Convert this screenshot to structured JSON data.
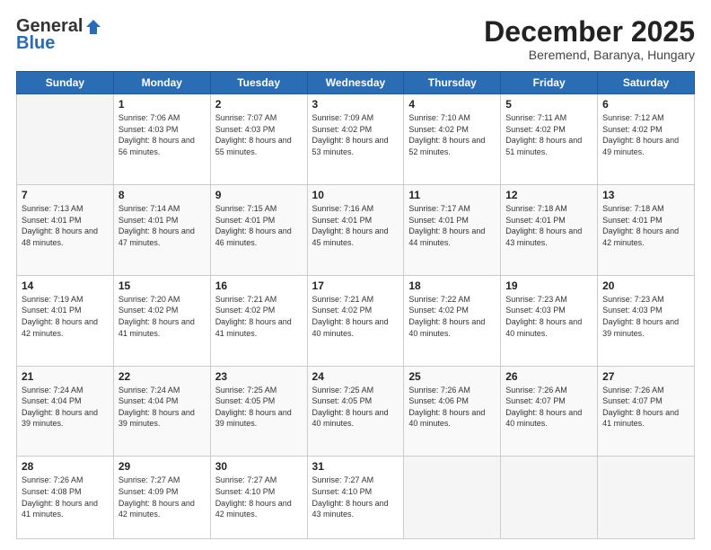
{
  "logo": {
    "general": "General",
    "blue": "Blue"
  },
  "title": "December 2025",
  "location": "Beremend, Baranya, Hungary",
  "headers": [
    "Sunday",
    "Monday",
    "Tuesday",
    "Wednesday",
    "Thursday",
    "Friday",
    "Saturday"
  ],
  "weeks": [
    [
      {
        "day": "",
        "sunrise": "",
        "sunset": "",
        "daylight": ""
      },
      {
        "day": "1",
        "sunrise": "Sunrise: 7:06 AM",
        "sunset": "Sunset: 4:03 PM",
        "daylight": "Daylight: 8 hours and 56 minutes."
      },
      {
        "day": "2",
        "sunrise": "Sunrise: 7:07 AM",
        "sunset": "Sunset: 4:03 PM",
        "daylight": "Daylight: 8 hours and 55 minutes."
      },
      {
        "day": "3",
        "sunrise": "Sunrise: 7:09 AM",
        "sunset": "Sunset: 4:02 PM",
        "daylight": "Daylight: 8 hours and 53 minutes."
      },
      {
        "day": "4",
        "sunrise": "Sunrise: 7:10 AM",
        "sunset": "Sunset: 4:02 PM",
        "daylight": "Daylight: 8 hours and 52 minutes."
      },
      {
        "day": "5",
        "sunrise": "Sunrise: 7:11 AM",
        "sunset": "Sunset: 4:02 PM",
        "daylight": "Daylight: 8 hours and 51 minutes."
      },
      {
        "day": "6",
        "sunrise": "Sunrise: 7:12 AM",
        "sunset": "Sunset: 4:02 PM",
        "daylight": "Daylight: 8 hours and 49 minutes."
      }
    ],
    [
      {
        "day": "7",
        "sunrise": "Sunrise: 7:13 AM",
        "sunset": "Sunset: 4:01 PM",
        "daylight": "Daylight: 8 hours and 48 minutes."
      },
      {
        "day": "8",
        "sunrise": "Sunrise: 7:14 AM",
        "sunset": "Sunset: 4:01 PM",
        "daylight": "Daylight: 8 hours and 47 minutes."
      },
      {
        "day": "9",
        "sunrise": "Sunrise: 7:15 AM",
        "sunset": "Sunset: 4:01 PM",
        "daylight": "Daylight: 8 hours and 46 minutes."
      },
      {
        "day": "10",
        "sunrise": "Sunrise: 7:16 AM",
        "sunset": "Sunset: 4:01 PM",
        "daylight": "Daylight: 8 hours and 45 minutes."
      },
      {
        "day": "11",
        "sunrise": "Sunrise: 7:17 AM",
        "sunset": "Sunset: 4:01 PM",
        "daylight": "Daylight: 8 hours and 44 minutes."
      },
      {
        "day": "12",
        "sunrise": "Sunrise: 7:18 AM",
        "sunset": "Sunset: 4:01 PM",
        "daylight": "Daylight: 8 hours and 43 minutes."
      },
      {
        "day": "13",
        "sunrise": "Sunrise: 7:18 AM",
        "sunset": "Sunset: 4:01 PM",
        "daylight": "Daylight: 8 hours and 42 minutes."
      }
    ],
    [
      {
        "day": "14",
        "sunrise": "Sunrise: 7:19 AM",
        "sunset": "Sunset: 4:01 PM",
        "daylight": "Daylight: 8 hours and 42 minutes."
      },
      {
        "day": "15",
        "sunrise": "Sunrise: 7:20 AM",
        "sunset": "Sunset: 4:02 PM",
        "daylight": "Daylight: 8 hours and 41 minutes."
      },
      {
        "day": "16",
        "sunrise": "Sunrise: 7:21 AM",
        "sunset": "Sunset: 4:02 PM",
        "daylight": "Daylight: 8 hours and 41 minutes."
      },
      {
        "day": "17",
        "sunrise": "Sunrise: 7:21 AM",
        "sunset": "Sunset: 4:02 PM",
        "daylight": "Daylight: 8 hours and 40 minutes."
      },
      {
        "day": "18",
        "sunrise": "Sunrise: 7:22 AM",
        "sunset": "Sunset: 4:02 PM",
        "daylight": "Daylight: 8 hours and 40 minutes."
      },
      {
        "day": "19",
        "sunrise": "Sunrise: 7:23 AM",
        "sunset": "Sunset: 4:03 PM",
        "daylight": "Daylight: 8 hours and 40 minutes."
      },
      {
        "day": "20",
        "sunrise": "Sunrise: 7:23 AM",
        "sunset": "Sunset: 4:03 PM",
        "daylight": "Daylight: 8 hours and 39 minutes."
      }
    ],
    [
      {
        "day": "21",
        "sunrise": "Sunrise: 7:24 AM",
        "sunset": "Sunset: 4:04 PM",
        "daylight": "Daylight: 8 hours and 39 minutes."
      },
      {
        "day": "22",
        "sunrise": "Sunrise: 7:24 AM",
        "sunset": "Sunset: 4:04 PM",
        "daylight": "Daylight: 8 hours and 39 minutes."
      },
      {
        "day": "23",
        "sunrise": "Sunrise: 7:25 AM",
        "sunset": "Sunset: 4:05 PM",
        "daylight": "Daylight: 8 hours and 39 minutes."
      },
      {
        "day": "24",
        "sunrise": "Sunrise: 7:25 AM",
        "sunset": "Sunset: 4:05 PM",
        "daylight": "Daylight: 8 hours and 40 minutes."
      },
      {
        "day": "25",
        "sunrise": "Sunrise: 7:26 AM",
        "sunset": "Sunset: 4:06 PM",
        "daylight": "Daylight: 8 hours and 40 minutes."
      },
      {
        "day": "26",
        "sunrise": "Sunrise: 7:26 AM",
        "sunset": "Sunset: 4:07 PM",
        "daylight": "Daylight: 8 hours and 40 minutes."
      },
      {
        "day": "27",
        "sunrise": "Sunrise: 7:26 AM",
        "sunset": "Sunset: 4:07 PM",
        "daylight": "Daylight: 8 hours and 41 minutes."
      }
    ],
    [
      {
        "day": "28",
        "sunrise": "Sunrise: 7:26 AM",
        "sunset": "Sunset: 4:08 PM",
        "daylight": "Daylight: 8 hours and 41 minutes."
      },
      {
        "day": "29",
        "sunrise": "Sunrise: 7:27 AM",
        "sunset": "Sunset: 4:09 PM",
        "daylight": "Daylight: 8 hours and 42 minutes."
      },
      {
        "day": "30",
        "sunrise": "Sunrise: 7:27 AM",
        "sunset": "Sunset: 4:10 PM",
        "daylight": "Daylight: 8 hours and 42 minutes."
      },
      {
        "day": "31",
        "sunrise": "Sunrise: 7:27 AM",
        "sunset": "Sunset: 4:10 PM",
        "daylight": "Daylight: 8 hours and 43 minutes."
      },
      {
        "day": "",
        "sunrise": "",
        "sunset": "",
        "daylight": ""
      },
      {
        "day": "",
        "sunrise": "",
        "sunset": "",
        "daylight": ""
      },
      {
        "day": "",
        "sunrise": "",
        "sunset": "",
        "daylight": ""
      }
    ]
  ]
}
